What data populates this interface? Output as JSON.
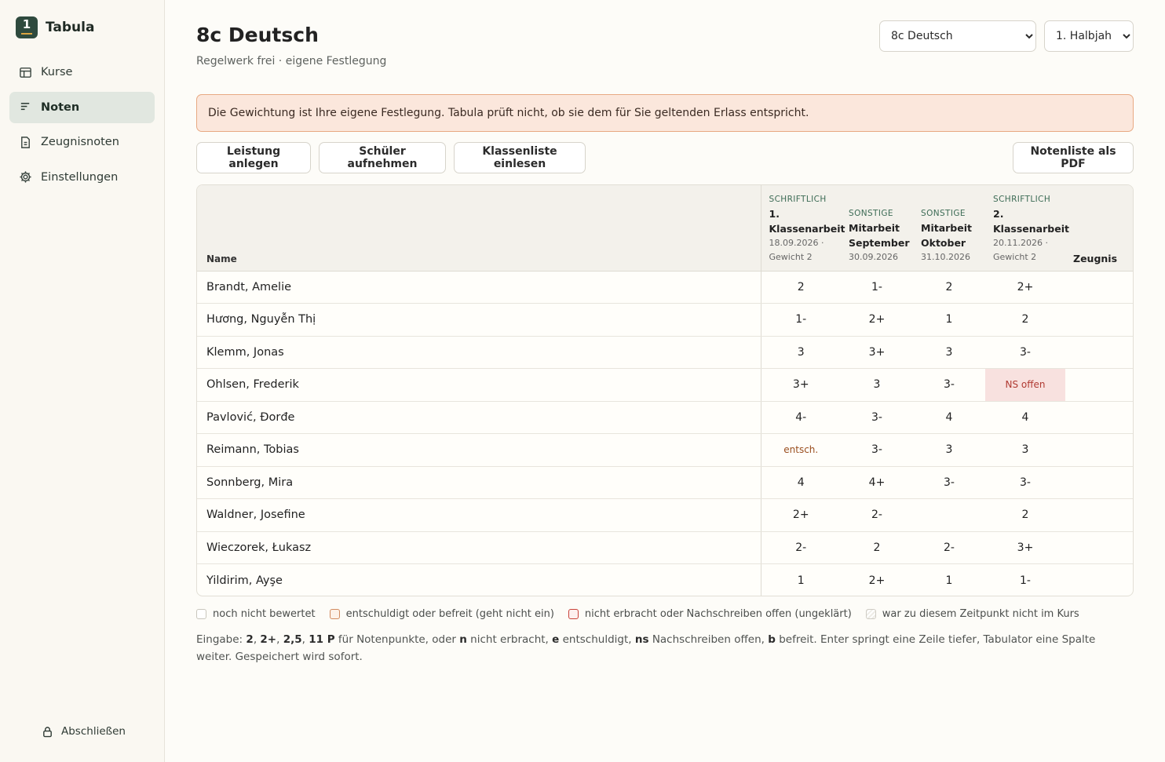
{
  "app": {
    "name": "Tabula",
    "logo_number": "1"
  },
  "sidebar": {
    "items": [
      {
        "label": "Kurse",
        "active": false
      },
      {
        "label": "Noten",
        "active": true
      },
      {
        "label": "Zeugnisnoten",
        "active": false
      },
      {
        "label": "Einstellungen",
        "active": false
      }
    ],
    "lock_label": "Abschließen"
  },
  "header": {
    "title": "8c Deutsch",
    "subtitle": "Regelwerk frei · eigene Festlegung",
    "course_select": {
      "selected": "8c Deutsch"
    },
    "term_select": {
      "selected": "1. Halbjahr"
    }
  },
  "notice": "Die Gewichtung ist Ihre eigene Festlegung. Tabula prüft nicht, ob sie dem für Sie geltenden Erlass entspricht.",
  "toolbar": {
    "add_performance": "Leistung anlegen",
    "add_student": "Schüler aufnehmen",
    "import_list": "Klassenliste einlesen",
    "export_pdf": "Notenliste als PDF"
  },
  "table": {
    "name_header": "Name",
    "columns": [
      {
        "kind": "SCHRIFTLICH",
        "title": "1. Klassenarbeit",
        "meta": "18.09.2026 · Gewicht 2"
      },
      {
        "kind": "SONSTIGE",
        "title": "Mitarbeit September",
        "meta": "30.09.2026"
      },
      {
        "kind": "SONSTIGE",
        "title": "Mitarbeit Oktober",
        "meta": "31.10.2026"
      },
      {
        "kind": "SCHRIFTLICH",
        "title": "2. Klassenarbeit",
        "meta": "20.11.2026 · Gewicht 2"
      }
    ],
    "report_header": "Zeugnis",
    "rows": [
      {
        "name": "Brandt, Amelie",
        "grades": [
          "2",
          "1-",
          "2",
          "2+"
        ],
        "report": ""
      },
      {
        "name": "Hương, Nguyễn Thị",
        "grades": [
          "1-",
          "2+",
          "1",
          "2"
        ],
        "report": ""
      },
      {
        "name": "Klemm, Jonas",
        "grades": [
          "3",
          "3+",
          "3",
          "3-"
        ],
        "report": ""
      },
      {
        "name": "Ohlsen, Frederik",
        "grades": [
          "3+",
          "3",
          "3-",
          "NS offen"
        ],
        "report": ""
      },
      {
        "name": "Pavlović, Đorđe",
        "grades": [
          "4-",
          "3-",
          "4",
          "4"
        ],
        "report": ""
      },
      {
        "name": "Reimann, Tobias",
        "grades": [
          "entsch.",
          "3-",
          "3",
          "3"
        ],
        "report": ""
      },
      {
        "name": "Sonnberg, Mira",
        "grades": [
          "4",
          "4+",
          "3-",
          "3-"
        ],
        "report": ""
      },
      {
        "name": "Waldner, Josefine",
        "grades": [
          "2+",
          "2-",
          "",
          "2"
        ],
        "report": ""
      },
      {
        "name": "Wieczorek, Łukasz",
        "grades": [
          "2-",
          "2",
          "2-",
          "3+"
        ],
        "report": ""
      },
      {
        "name": "Yildirim, Ayşe",
        "grades": [
          "1",
          "2+",
          "1",
          "1-"
        ],
        "report": ""
      }
    ]
  },
  "legend": {
    "not_graded": "noch nicht bewertet",
    "excused": "entschuldigt oder befreit (geht nicht ein)",
    "missing": "nicht erbracht oder Nachschreiben offen (ungeklärt)",
    "absent": "war zu diesem Zeitpunkt nicht im Kurs"
  },
  "help": {
    "intro": "Eingabe:",
    "ex1": "2",
    "ex2": "2+",
    "ex3": "2,5",
    "ex4": "11 P",
    "t1": "für Notenpunkte, oder",
    "k_n": "n",
    "t_n": "nicht erbracht,",
    "k_e": "e",
    "t_e": "entschuldigt,",
    "k_ns": "ns",
    "t_ns": "Nachschreiben offen,",
    "k_b": "b",
    "t_b": "befreit. Enter springt eine Zeile tiefer, Tabulator eine Spalte weiter. Gespeichert wird sofort."
  }
}
